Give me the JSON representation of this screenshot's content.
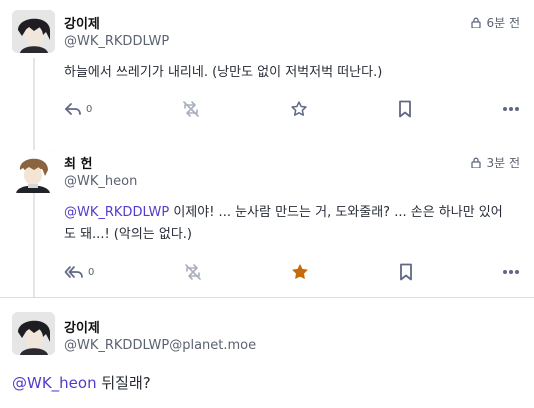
{
  "statuses": [
    {
      "display_name": "강이제",
      "acct": "@WK_RKDDLWP",
      "visibility_icon": "lock-icon",
      "time": "6분 전",
      "text": "하늘에서 쓰레기가 내리네. (낭만도 없이 저벅저벅 떠난다.)",
      "reply_count": "0",
      "favourited": false
    },
    {
      "display_name": "최 헌",
      "acct": "@WK_heon",
      "visibility_icon": "lock-icon",
      "time": "3분 전",
      "mention": "@WK_RKDDLWP",
      "text": " 이제야! ... 눈사람 만드는 거, 도와줄래? ... 손은 하나만 있어도 돼...! (악의는 없다.)",
      "reply_count": "0",
      "favourited": true
    },
    {
      "display_name": "강이제",
      "acct": "@WK_RKDDLWP@planet.moe",
      "mention": "@WK_heon",
      "text": " 뒤질래?"
    }
  ],
  "colors": {
    "mention": "#563acc",
    "favourite_active": "#ca8f04",
    "icon": "#606984"
  }
}
